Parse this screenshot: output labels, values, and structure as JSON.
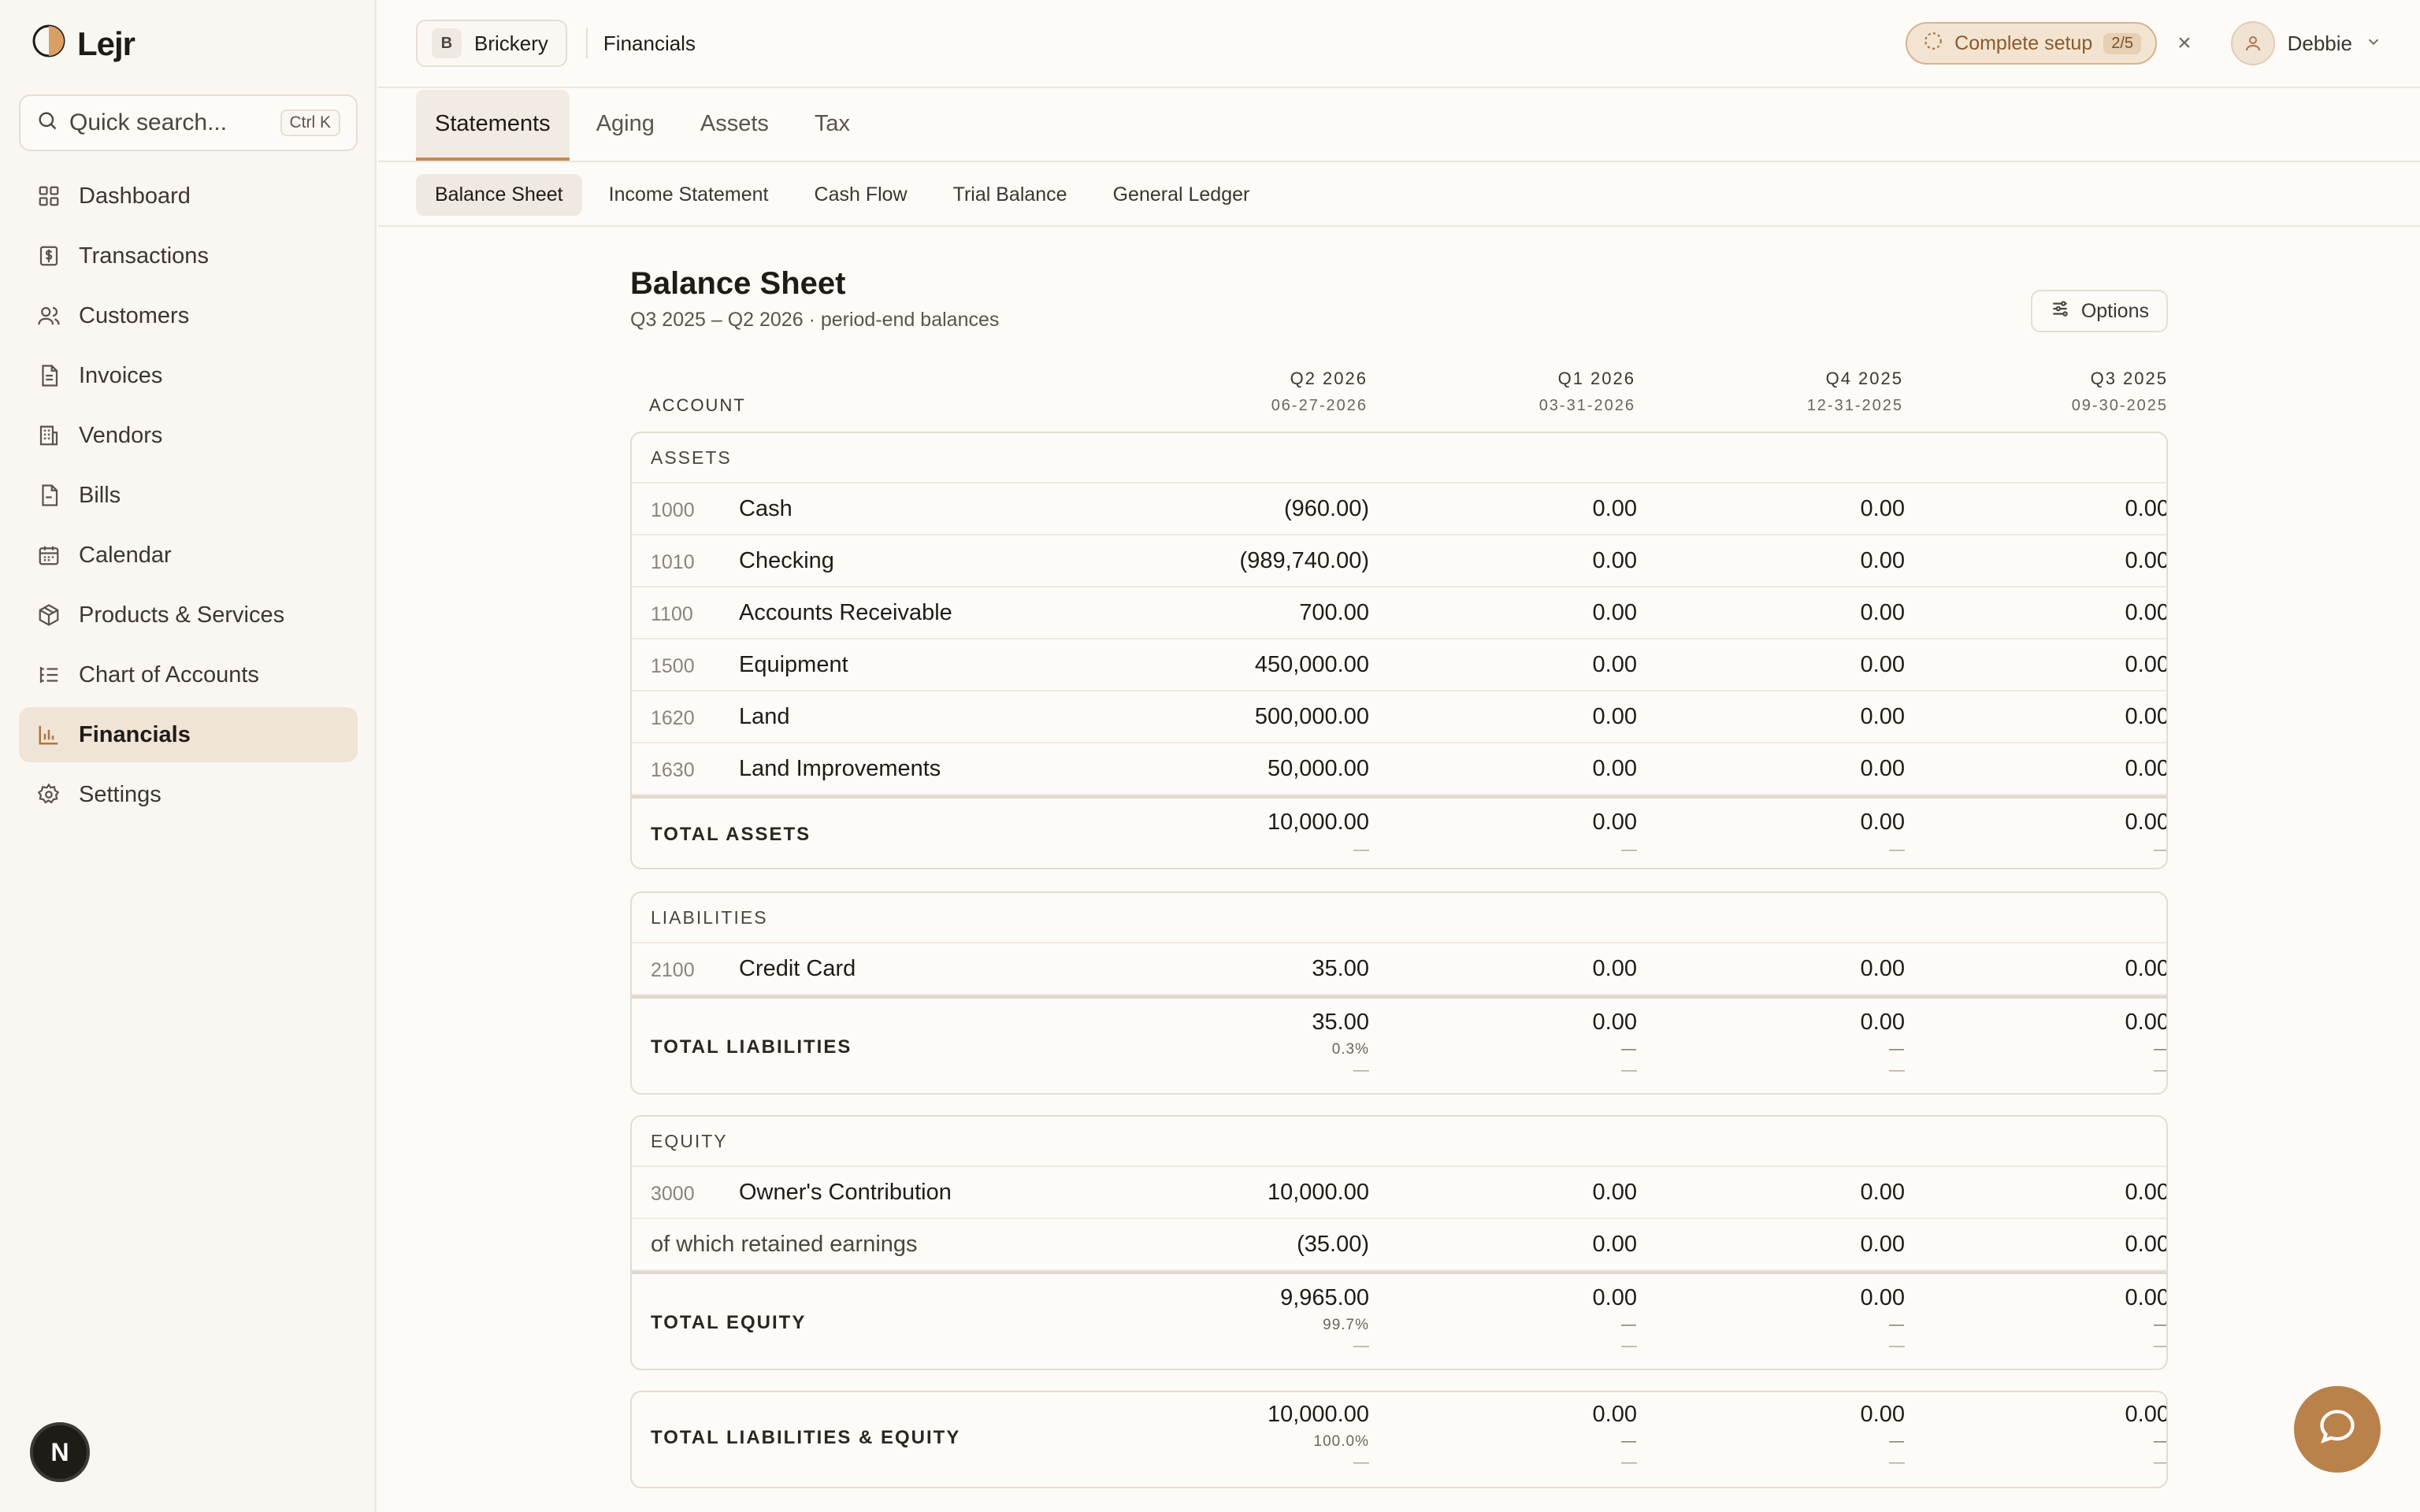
{
  "app": {
    "name": "Lejr"
  },
  "search": {
    "placeholder": "Quick search...",
    "shortcut": "Ctrl K"
  },
  "sidebar": {
    "items": [
      {
        "label": "Dashboard",
        "icon": "grid-icon"
      },
      {
        "label": "Transactions",
        "icon": "dollar-doc-icon"
      },
      {
        "label": "Customers",
        "icon": "users-icon"
      },
      {
        "label": "Invoices",
        "icon": "document-icon"
      },
      {
        "label": "Vendors",
        "icon": "building-icon"
      },
      {
        "label": "Bills",
        "icon": "file-icon"
      },
      {
        "label": "Calendar",
        "icon": "calendar-icon"
      },
      {
        "label": "Products & Services",
        "icon": "box-icon"
      },
      {
        "label": "Chart of Accounts",
        "icon": "list-tree-icon"
      },
      {
        "label": "Financials",
        "icon": "bar-chart-icon",
        "active": true
      },
      {
        "label": "Settings",
        "icon": "gear-icon"
      }
    ],
    "footer_badge": "N"
  },
  "header": {
    "org_initial": "B",
    "org_name": "Brickery",
    "breadcrumb": "Financials",
    "setup_label": "Complete setup",
    "setup_progress": "2/5",
    "setup_close": "×",
    "user_name": "Debbie"
  },
  "tabs": [
    "Statements",
    "Aging",
    "Assets",
    "Tax"
  ],
  "subtabs": [
    "Balance Sheet",
    "Income Statement",
    "Cash Flow",
    "Trial Balance",
    "General Ledger"
  ],
  "report": {
    "title": "Balance Sheet",
    "subtitle": "Q3 2025 – Q2 2026 · period-end balances",
    "options_label": "Options",
    "account_header": "ACCOUNT",
    "columns": [
      {
        "period": "Q2 2026",
        "date": "06-27-2026"
      },
      {
        "period": "Q1 2026",
        "date": "03-31-2026"
      },
      {
        "period": "Q4 2025",
        "date": "12-31-2025"
      },
      {
        "period": "Q3 2025",
        "date": "09-30-2025"
      }
    ],
    "assets": {
      "label": "ASSETS",
      "rows": [
        {
          "code": "1000",
          "name": "Cash",
          "values": [
            "(960.00)",
            "0.00",
            "0.00",
            "0.00"
          ]
        },
        {
          "code": "1010",
          "name": "Checking",
          "values": [
            "(989,740.00)",
            "0.00",
            "0.00",
            "0.00"
          ]
        },
        {
          "code": "1100",
          "name": "Accounts Receivable",
          "values": [
            "700.00",
            "0.00",
            "0.00",
            "0.00"
          ]
        },
        {
          "code": "1500",
          "name": "Equipment",
          "values": [
            "450,000.00",
            "0.00",
            "0.00",
            "0.00"
          ]
        },
        {
          "code": "1620",
          "name": "Land",
          "values": [
            "500,000.00",
            "0.00",
            "0.00",
            "0.00"
          ]
        },
        {
          "code": "1630",
          "name": "Land Improvements",
          "values": [
            "50,000.00",
            "0.00",
            "0.00",
            "0.00"
          ]
        }
      ],
      "total_label": "TOTAL ASSETS",
      "totals": [
        "10,000.00",
        "0.00",
        "0.00",
        "0.00"
      ]
    },
    "liabilities": {
      "label": "LIABILITIES",
      "rows": [
        {
          "code": "2100",
          "name": "Credit Card",
          "values": [
            "35.00",
            "0.00",
            "0.00",
            "0.00"
          ]
        }
      ],
      "total_label": "TOTAL LIABILITIES",
      "totals": [
        "35.00",
        "0.00",
        "0.00",
        "0.00"
      ],
      "pcts": [
        "0.3%",
        "—",
        "—",
        "—"
      ]
    },
    "equity": {
      "label": "EQUITY",
      "rows": [
        {
          "code": "3000",
          "name": "Owner's Contribution",
          "values": [
            "10,000.00",
            "0.00",
            "0.00",
            "0.00"
          ]
        },
        {
          "code": "",
          "name": "of which retained earnings",
          "values": [
            "(35.00)",
            "0.00",
            "0.00",
            "0.00"
          ]
        }
      ],
      "total_label": "TOTAL EQUITY",
      "totals": [
        "9,965.00",
        "0.00",
        "0.00",
        "0.00"
      ],
      "pcts": [
        "99.7%",
        "—",
        "—",
        "—"
      ]
    },
    "grand": {
      "total_label": "TOTAL LIABILITIES & EQUITY",
      "totals": [
        "10,000.00",
        "0.00",
        "0.00",
        "0.00"
      ],
      "pcts": [
        "100.0%",
        "—",
        "—",
        "—"
      ]
    },
    "dash": "—"
  },
  "colors": {
    "accent": "#b9824a",
    "active_nav": "#efe4d6",
    "setup_bg": "#f3e4d2"
  }
}
